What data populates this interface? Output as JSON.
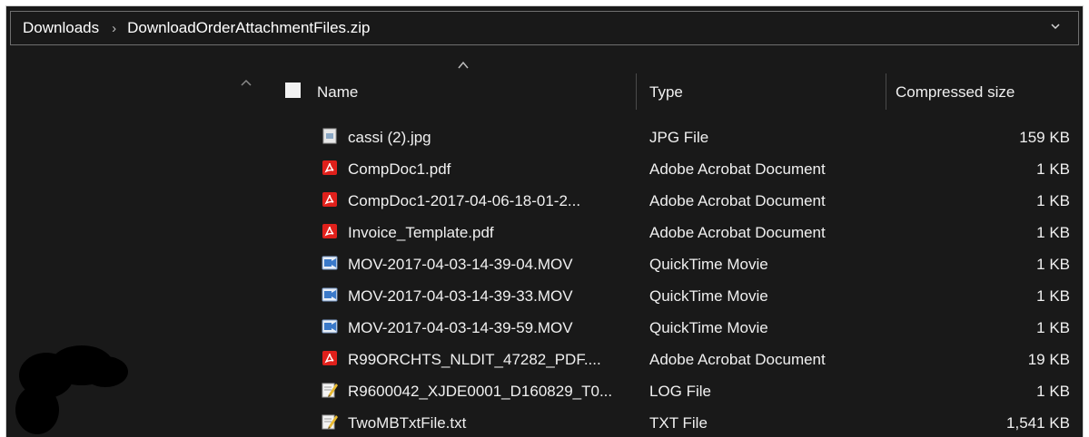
{
  "address": {
    "crumbs": [
      "Downloads",
      "DownloadOrderAttachmentFiles.zip"
    ],
    "separator": "›",
    "dropdown_icon": "chevron-down-icon"
  },
  "columns": {
    "name": "Name",
    "type": "Type",
    "size": "Compressed size",
    "sorted_by": "Name"
  },
  "files": [
    {
      "name": "cassi (2).jpg",
      "type": "JPG File",
      "size": "159 KB",
      "icon": "image-file-icon"
    },
    {
      "name": "CompDoc1.pdf",
      "type": "Adobe Acrobat Document",
      "size": "1 KB",
      "icon": "pdf-file-icon"
    },
    {
      "name": "CompDoc1-2017-04-06-18-01-2...",
      "type": "Adobe Acrobat Document",
      "size": "1 KB",
      "icon": "pdf-file-icon"
    },
    {
      "name": "Invoice_Template.pdf",
      "type": "Adobe Acrobat Document",
      "size": "1 KB",
      "icon": "pdf-file-icon"
    },
    {
      "name": "MOV-2017-04-03-14-39-04.MOV",
      "type": "QuickTime Movie",
      "size": "1 KB",
      "icon": "video-file-icon"
    },
    {
      "name": "MOV-2017-04-03-14-39-33.MOV",
      "type": "QuickTime Movie",
      "size": "1 KB",
      "icon": "video-file-icon"
    },
    {
      "name": "MOV-2017-04-03-14-39-59.MOV",
      "type": "QuickTime Movie",
      "size": "1 KB",
      "icon": "video-file-icon"
    },
    {
      "name": "R99ORCHTS_NLDIT_47282_PDF....",
      "type": "Adobe Acrobat Document",
      "size": "19 KB",
      "icon": "pdf-file-icon"
    },
    {
      "name": "R9600042_XJDE0001_D160829_T0...",
      "type": "LOG File",
      "size": "1 KB",
      "icon": "log-file-icon"
    },
    {
      "name": "TwoMBTxtFile.txt",
      "type": "TXT File",
      "size": "1,541 KB",
      "icon": "text-file-icon"
    }
  ],
  "colors": {
    "background": "#191919",
    "text": "#f0f0f0",
    "pdf_red": "#e0201b",
    "video_blue": "#3a79c9"
  }
}
